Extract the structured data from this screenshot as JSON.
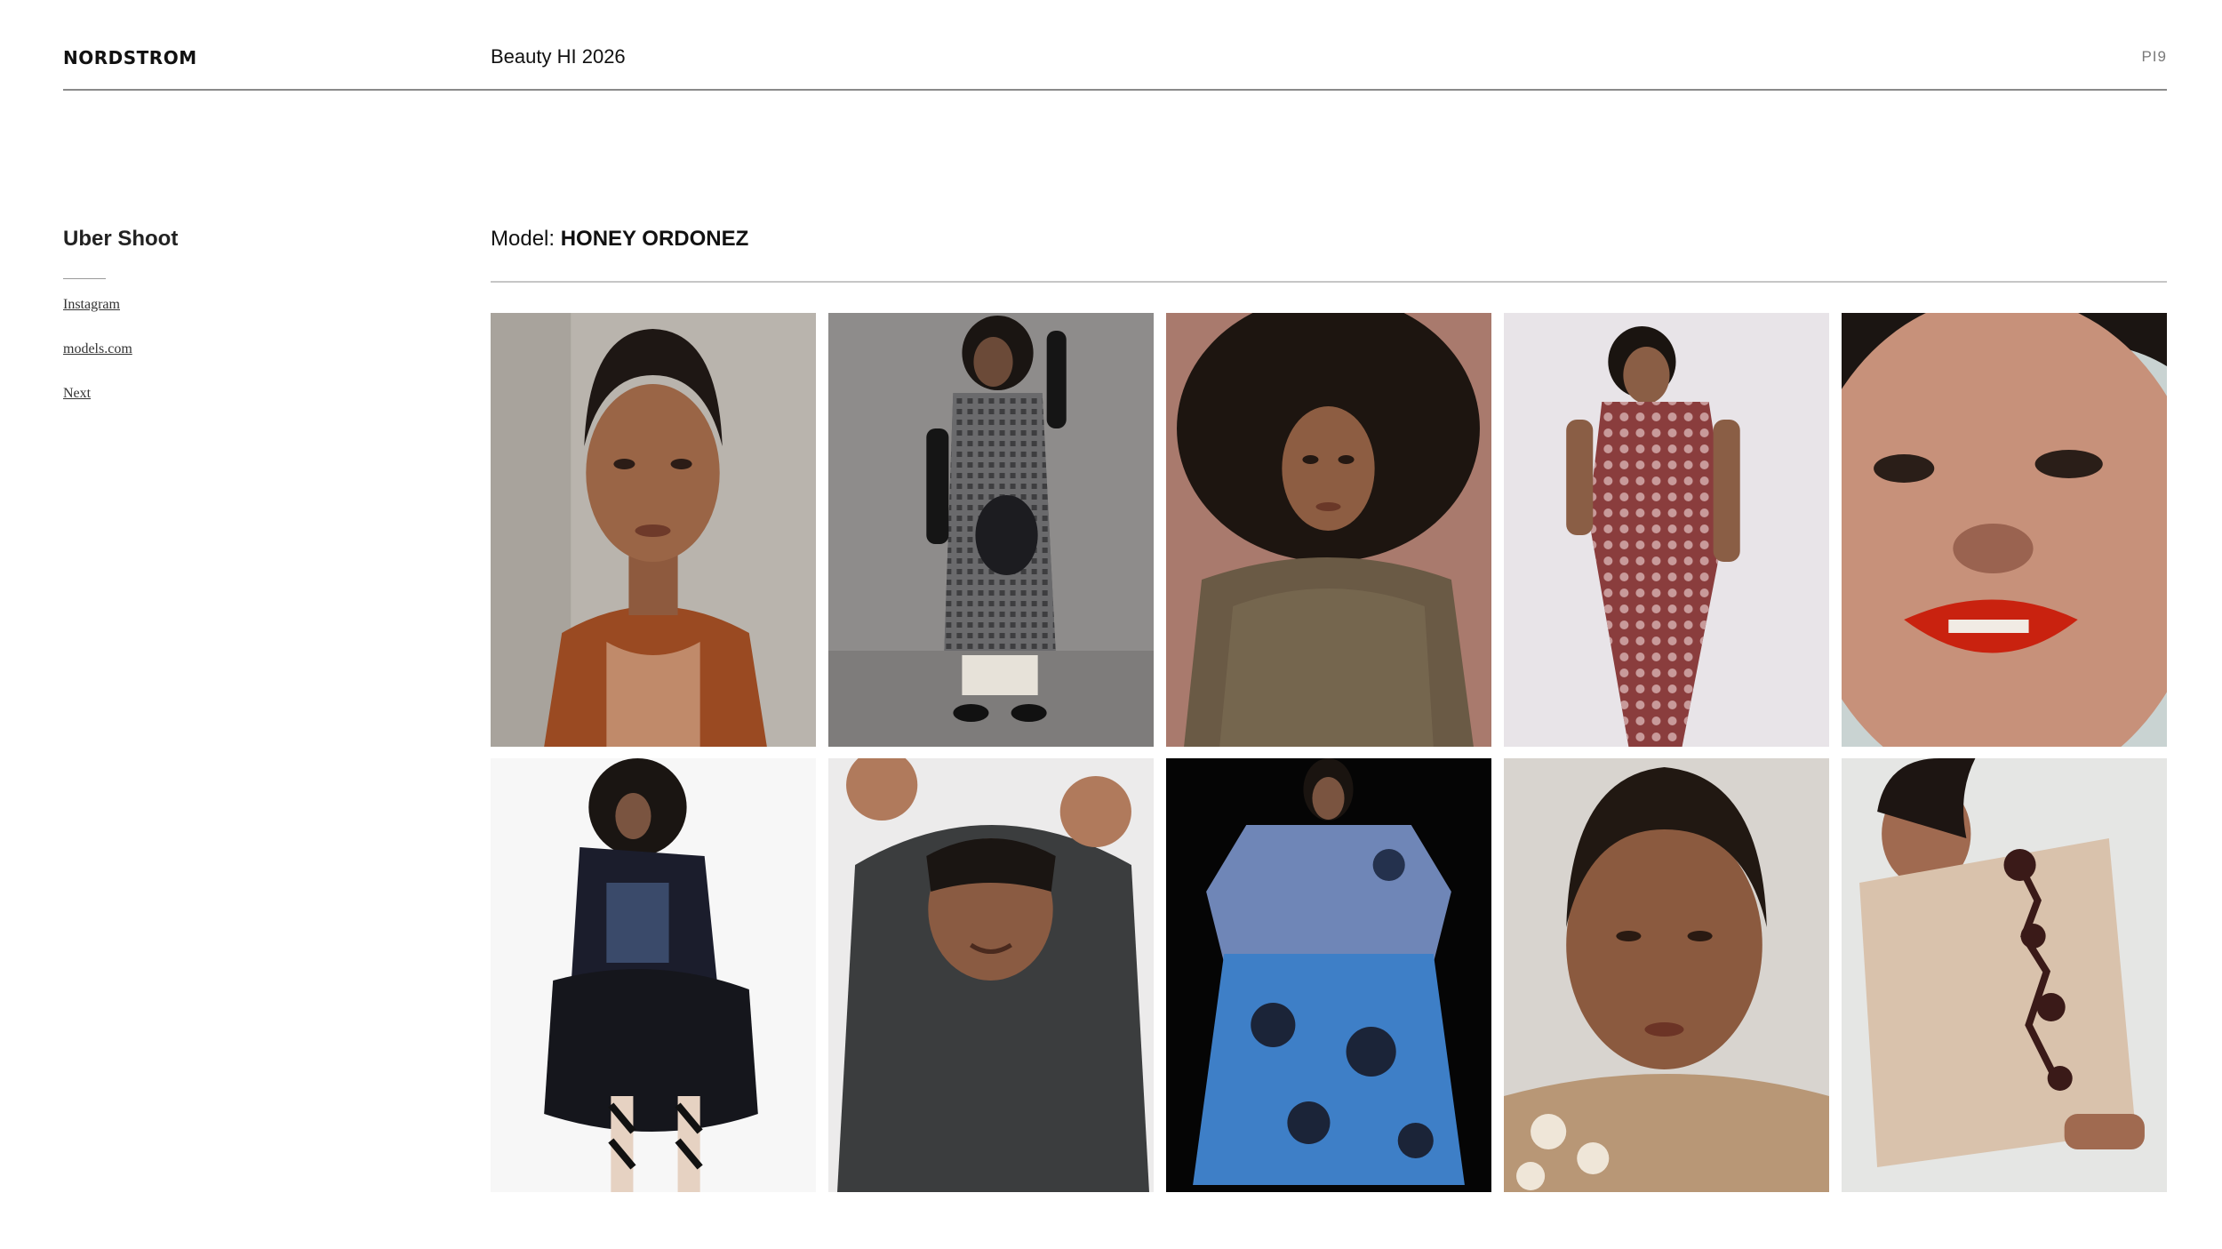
{
  "header": {
    "logo": "NORDSTROM",
    "title": "Beauty HI 2026",
    "page_number": "PI9"
  },
  "sidebar": {
    "title": "Uber Shoot",
    "links": [
      {
        "label": "Instagram"
      },
      {
        "label": "models.com"
      },
      {
        "label": "Next"
      }
    ]
  },
  "main": {
    "model_prefix": "Model: ",
    "model_name": "HONEY ORDONEZ",
    "photos": [
      {
        "subject": "portrait-rust-tank"
      },
      {
        "subject": "plaid-dress-gloves"
      },
      {
        "subject": "curly-hair-knit"
      },
      {
        "subject": "crochet-dress"
      },
      {
        "subject": "red-lips-closeup"
      },
      {
        "subject": "black-tulle-skirt"
      },
      {
        "subject": "grey-hoodie"
      },
      {
        "subject": "blue-floral-skirt"
      },
      {
        "subject": "slick-hair-portrait"
      },
      {
        "subject": "sheer-floral-top"
      }
    ]
  },
  "colors": {
    "rule": "#8a8a8a",
    "link": "#333333"
  }
}
